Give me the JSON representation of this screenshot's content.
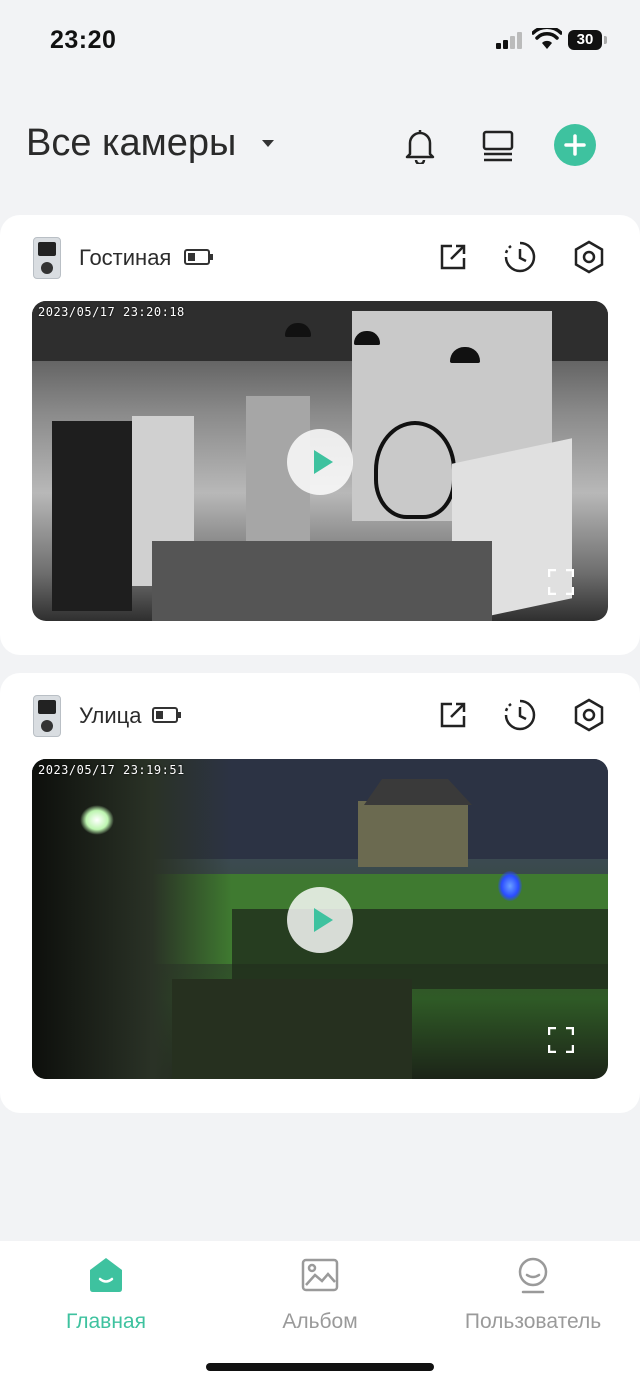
{
  "status_bar": {
    "time": "23:20",
    "battery_level": "30"
  },
  "header": {
    "title": "Все камеры",
    "accent_color": "#3ec29f"
  },
  "cameras": [
    {
      "name": "Гостиная",
      "timestamp": "2023/05/17 23:20:18",
      "battery_icon": "battery-low-icon"
    },
    {
      "name": "Улица",
      "timestamp": "2023/05/17 23:19:51",
      "battery_icon": "battery-low-icon"
    }
  ],
  "bottom_nav": {
    "items": [
      {
        "label": "Главная",
        "icon": "home-icon",
        "active": true
      },
      {
        "label": "Альбом",
        "icon": "album-icon",
        "active": false
      },
      {
        "label": "Пользователь",
        "icon": "user-icon",
        "active": false
      }
    ]
  }
}
